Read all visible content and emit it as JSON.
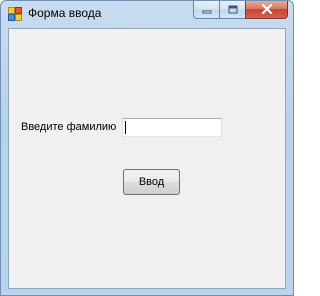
{
  "window": {
    "title": "Форма ввода",
    "icon": "winforms-app-icon",
    "caption_buttons": [
      "minimize-icon",
      "maximize-icon",
      "close-icon"
    ]
  },
  "form": {
    "surname_label": "Введите фамилию",
    "surname_value": "",
    "submit_label": "Ввод"
  },
  "colors": {
    "client_background": "#f0f0f0",
    "close_button": "#c7442f",
    "titlebar": "#bcd3ec"
  }
}
